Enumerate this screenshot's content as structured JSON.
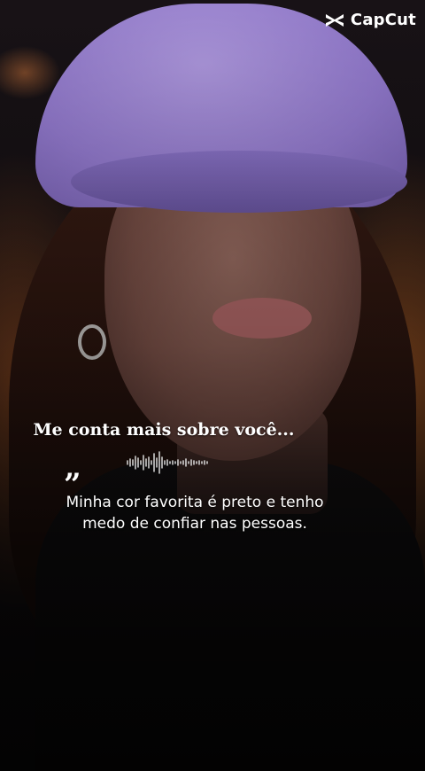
{
  "watermark": {
    "brand": "CapCut",
    "icon": "capcut-logo-icon"
  },
  "caption": {
    "title": "Me conta mais sobre você...",
    "quote_mark": "”",
    "text_line1": "Minha cor favorita é preto e tenho",
    "text_line2": "medo de confiar nas pessoas."
  },
  "colors": {
    "cap": "#9a80d8",
    "text": "#ffffff",
    "glow": "#e0782a"
  }
}
